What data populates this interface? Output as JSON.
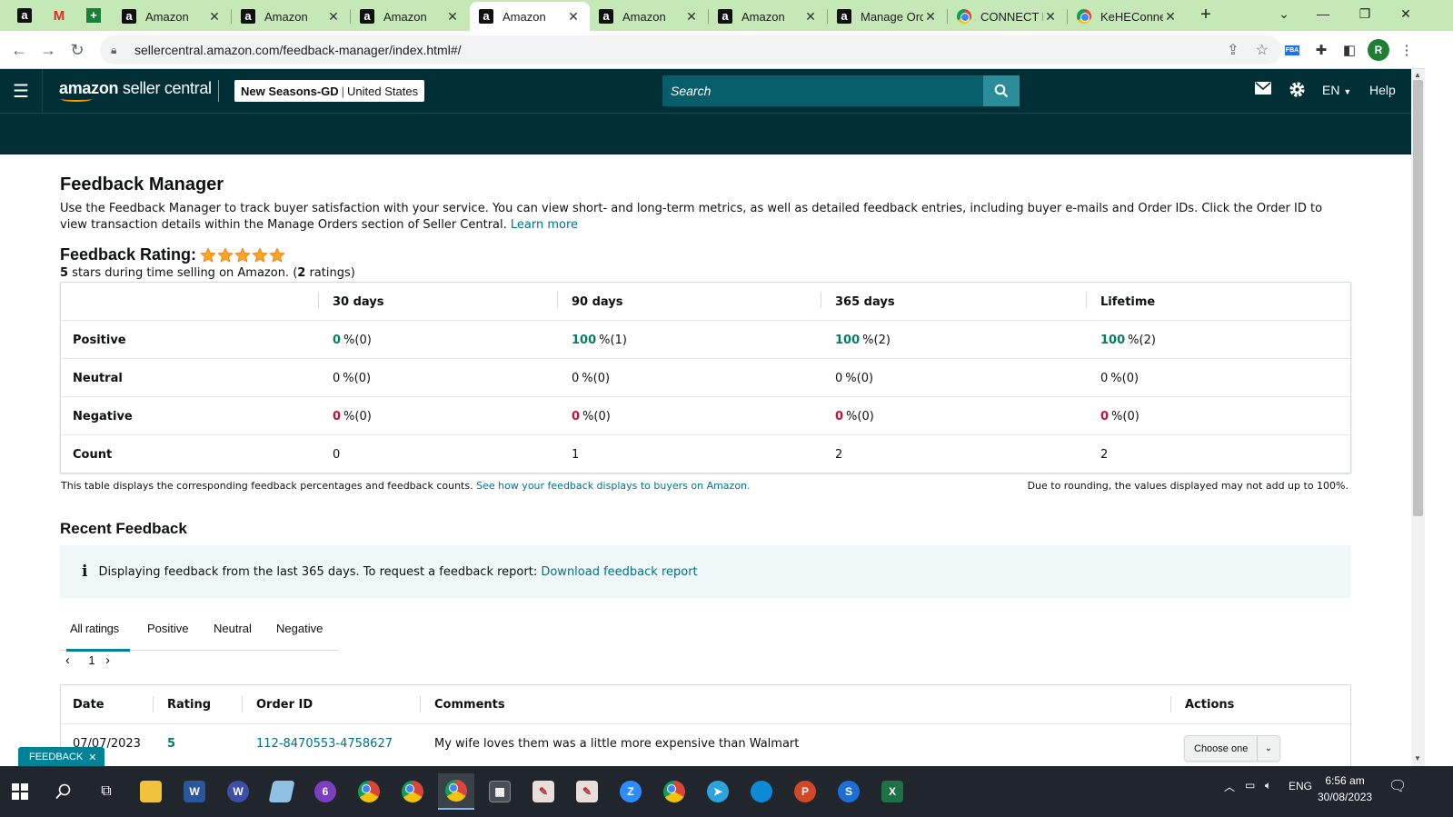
{
  "browser": {
    "tabs": [
      {
        "label": "Amazon",
        "favicon": "amazon-favicon",
        "active": false
      },
      {
        "label": "Amazon",
        "favicon": "amazon-favicon",
        "active": false
      },
      {
        "label": "Amazon",
        "favicon": "amazon-favicon",
        "active": false
      },
      {
        "label": "Amazon",
        "favicon": "amazon-favicon",
        "active": true
      },
      {
        "label": "Amazon",
        "favicon": "amazon-favicon",
        "active": false
      },
      {
        "label": "Amazon",
        "favicon": "amazon-favicon",
        "active": false
      },
      {
        "label": "Manage Orde",
        "favicon": "amazon-favicon",
        "active": false
      },
      {
        "label": "CONNECT Re",
        "favicon": "chrome-favicon",
        "active": false
      },
      {
        "label": "KeHEConnec",
        "favicon": "chrome-favicon",
        "active": false
      }
    ],
    "url": "sellercentral.amazon.com/feedback-manager/index.html#/",
    "profile_initial": "R",
    "ext_fba": "FBA"
  },
  "header": {
    "logo_bold": "amazon",
    "logo_rest": " seller central",
    "store_name": "New Seasons-GD",
    "store_region": "United States",
    "search_placeholder": "Search",
    "lang": "EN",
    "help": "Help"
  },
  "page": {
    "title": "Feedback Manager",
    "intro": "Use the Feedback Manager to track buyer satisfaction with your service. You can view short- and long-term metrics, as well as detailed feedback entries, including buyer e-mails and Order IDs. Click the Order ID to view transaction details within the Manage Orders section of Seller Central.",
    "learn_more": "Learn more",
    "rating_title": "Feedback Rating:",
    "stars": 5,
    "rating_stars_count": "5",
    "rating_sub_mid": " stars during time selling on Amazon. (",
    "rating_count": "2",
    "rating_sub_end": " ratings)",
    "metrics": {
      "columns": [
        "30 days",
        "90 days",
        "365 days",
        "Lifetime"
      ],
      "rows": [
        {
          "label": "Positive",
          "cells": [
            {
              "pct": "0",
              "rest": "%(0)"
            },
            {
              "pct": "100",
              "rest": "%(1)"
            },
            {
              "pct": "100",
              "rest": "%(2)"
            },
            {
              "pct": "100",
              "rest": "%(2)"
            }
          ]
        },
        {
          "label": "Neutral",
          "cells": [
            {
              "pct": "0",
              "rest": "%(0)"
            },
            {
              "pct": "0",
              "rest": "%(0)"
            },
            {
              "pct": "0",
              "rest": "%(0)"
            },
            {
              "pct": "0",
              "rest": "%(0)"
            }
          ]
        },
        {
          "label": "Negative",
          "cells": [
            {
              "pct": "0",
              "rest": "%(0)"
            },
            {
              "pct": "0",
              "rest": "%(0)"
            },
            {
              "pct": "0",
              "rest": "%(0)"
            },
            {
              "pct": "0",
              "rest": "%(0)"
            }
          ]
        },
        {
          "label": "Count",
          "cells": [
            {
              "pct": "0",
              "rest": ""
            },
            {
              "pct": "1",
              "rest": ""
            },
            {
              "pct": "2",
              "rest": ""
            },
            {
              "pct": "2",
              "rest": ""
            }
          ]
        }
      ]
    },
    "table_note": "This table displays the corresponding feedback percentages and feedback counts.",
    "table_note_link": "See how your feedback displays to buyers on Amazon.",
    "rounding_note": "Due to rounding, the values displayed may not add up to 100%.",
    "recent_title": "Recent Feedback",
    "info_text": "Displaying feedback from the last 365 days. To request a feedback report:",
    "info_link": "Download feedback report",
    "filter_tabs": [
      "All ratings",
      "Positive",
      "Neutral",
      "Negative"
    ],
    "page_number": "1",
    "feedback_table": {
      "headers": [
        "Date",
        "Rating",
        "Order ID",
        "Comments",
        "Actions"
      ],
      "rows": [
        {
          "date": "07/07/2023",
          "rating": "5",
          "order_id": "112-8470553-4758627",
          "comment": "My wife loves them was a little more expensive than Walmart",
          "action": "Choose one"
        }
      ]
    },
    "feedback_button": "FEEDBACK"
  },
  "taskbar": {
    "lang": "ENG",
    "time": "6:56 am",
    "date": "30/08/2023"
  },
  "colors": {
    "header_bg": "#002f36",
    "search_bg": "#065e6b",
    "link": "#007185",
    "positive": "#067d62",
    "negative": "#cc0c39",
    "tabbar": "#c5e8b7"
  }
}
